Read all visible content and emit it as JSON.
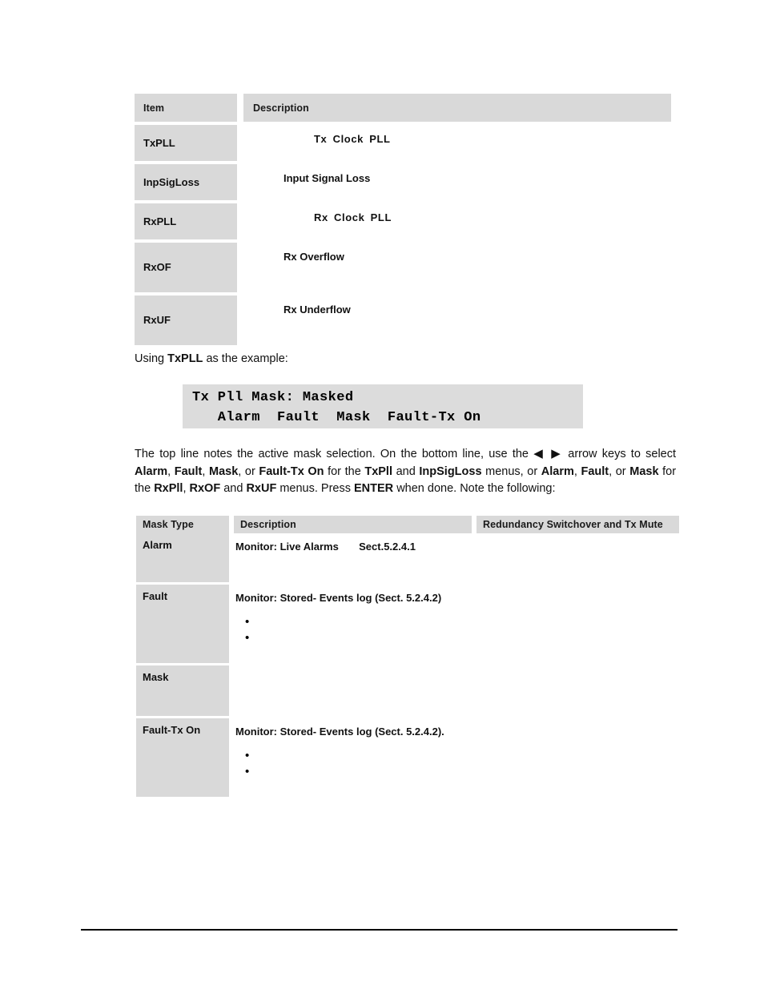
{
  "item_table": {
    "headers": [
      "Item",
      "Description"
    ],
    "rows": [
      {
        "item": "TxPLL",
        "description": "Tx  Clock  PLL",
        "style": "wide"
      },
      {
        "item": "InpSigLoss",
        "description": "Input Signal Loss",
        "style": "narrow"
      },
      {
        "item": "RxPLL",
        "description": "Rx  Clock  PLL",
        "style": "wide"
      },
      {
        "item": "RxOF",
        "description": "Rx Overflow",
        "style": "narrow"
      },
      {
        "item": "RxUF",
        "description": "Rx Underflow",
        "style": "narrow"
      }
    ]
  },
  "using_line": {
    "prefix": "Using ",
    "bold": "TxPLL",
    "suffix": " as the example:"
  },
  "lcd": {
    "line1": "Tx Pll Mask: Masked",
    "line2": "   Alarm  Fault  Mask  Fault-Tx On"
  },
  "mask_paragraph": {
    "line1_a": "The top line notes the active mask selection. On the bottom line, use the ",
    "arrows": "◀ ▶",
    "line1_b": " arrow keys to",
    "line2_a": "select ",
    "line2_b1": "Alarm",
    "line2_c": ", ",
    "line2_b2": "Fault",
    "line2_d": ", ",
    "line2_b3": "Mask",
    "line2_e": ", or ",
    "line2_b4": "Fault-Tx On",
    "line2_f": " for the ",
    "line2_b5": "TxPll",
    "line2_g": " and ",
    "line2_b6": "InpSigLoss",
    "line2_h": " menus, or ",
    "line2_b7": "Alarm",
    "line2_i": ", ",
    "line2_b8": "Fault",
    "line2_j": ", or",
    "line3_b1": "Mask",
    "line3_a": " for the ",
    "line3_b2": "RxPll",
    "line3_b": ", ",
    "line3_b3": "RxOF",
    "line3_c": " and ",
    "line3_b4": "RxUF",
    "line3_d": " menus. Press ",
    "line3_b5": "ENTER",
    "line3_e": " when done. Note the following:"
  },
  "mask_table": {
    "headers": [
      "Mask Type",
      "Description",
      "Redundancy Switchover and Tx Mute"
    ],
    "rows": [
      {
        "type": "Alarm",
        "desc_line1": "Monitor: Live",
        "desc_line2_a": "Alarms",
        "desc_line2_b": "Sect.5.2.4.1",
        "bullets": 0,
        "redundancy": ""
      },
      {
        "type": "Fault",
        "desc_line1": "Monitor: Stored-",
        "desc_line2_a": "Events log (Sect. 5.2.4.2)",
        "desc_line2_b": "",
        "bullets": 2,
        "redundancy": ""
      },
      {
        "type": "Mask",
        "desc_line1": "",
        "desc_line2_a": "",
        "desc_line2_b": "",
        "bullets": 0,
        "redundancy": ""
      },
      {
        "type": "Fault-Tx On",
        "desc_line1": "Monitor: Stored-",
        "desc_line2_a": "Events log (Sect. 5.2.4.2).",
        "desc_line2_b": "",
        "bullets": 2,
        "redundancy": ""
      }
    ]
  },
  "colors": {
    "cell_gray": "#d9d9d9",
    "lcd_gray": "#dcdcdc",
    "text": "#111111"
  }
}
